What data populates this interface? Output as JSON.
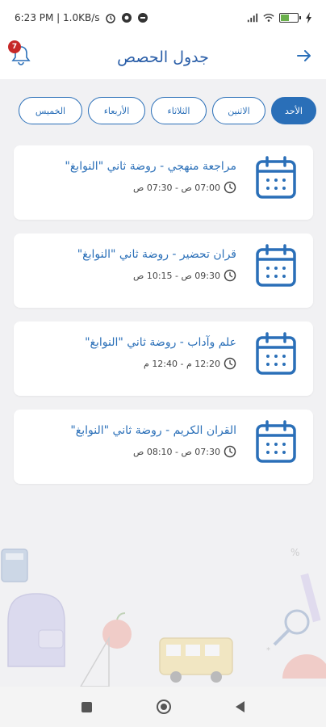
{
  "status_bar": {
    "time_speed": "6:23 PM | 1.0KB/s"
  },
  "header": {
    "title": "جدول الحصص",
    "notification_count": "7"
  },
  "tabs": [
    {
      "label": "الأحد",
      "active": true
    },
    {
      "label": "الاثنين",
      "active": false
    },
    {
      "label": "الثلاثاء",
      "active": false
    },
    {
      "label": "الأربعاء",
      "active": false
    },
    {
      "label": "الخميس",
      "active": false
    }
  ],
  "lessons": [
    {
      "title": "مراجعة منهجي - روضة ثاني \"النوابغ\"",
      "time": "07:00 ص - 07:30 ص"
    },
    {
      "title": "قران تحضير - روضة ثاني \"النوابغ\"",
      "time": "09:30 ص - 10:15 ص"
    },
    {
      "title": "علم وآداب  - روضة ثاني \"النوابغ\"",
      "time": "12:20 م - 12:40 م"
    },
    {
      "title": "القران الكريم - روضة ثاني \"النوابغ\"",
      "time": "07:30 ص - 08:10 ص"
    }
  ],
  "colors": {
    "accent": "#2a6fb8",
    "badge": "#c62828",
    "background": "#f1f1f3"
  },
  "icons": {
    "back": "arrow-right-icon",
    "notifications": "bell-icon",
    "lesson": "calendar-icon",
    "time": "clock-icon"
  }
}
